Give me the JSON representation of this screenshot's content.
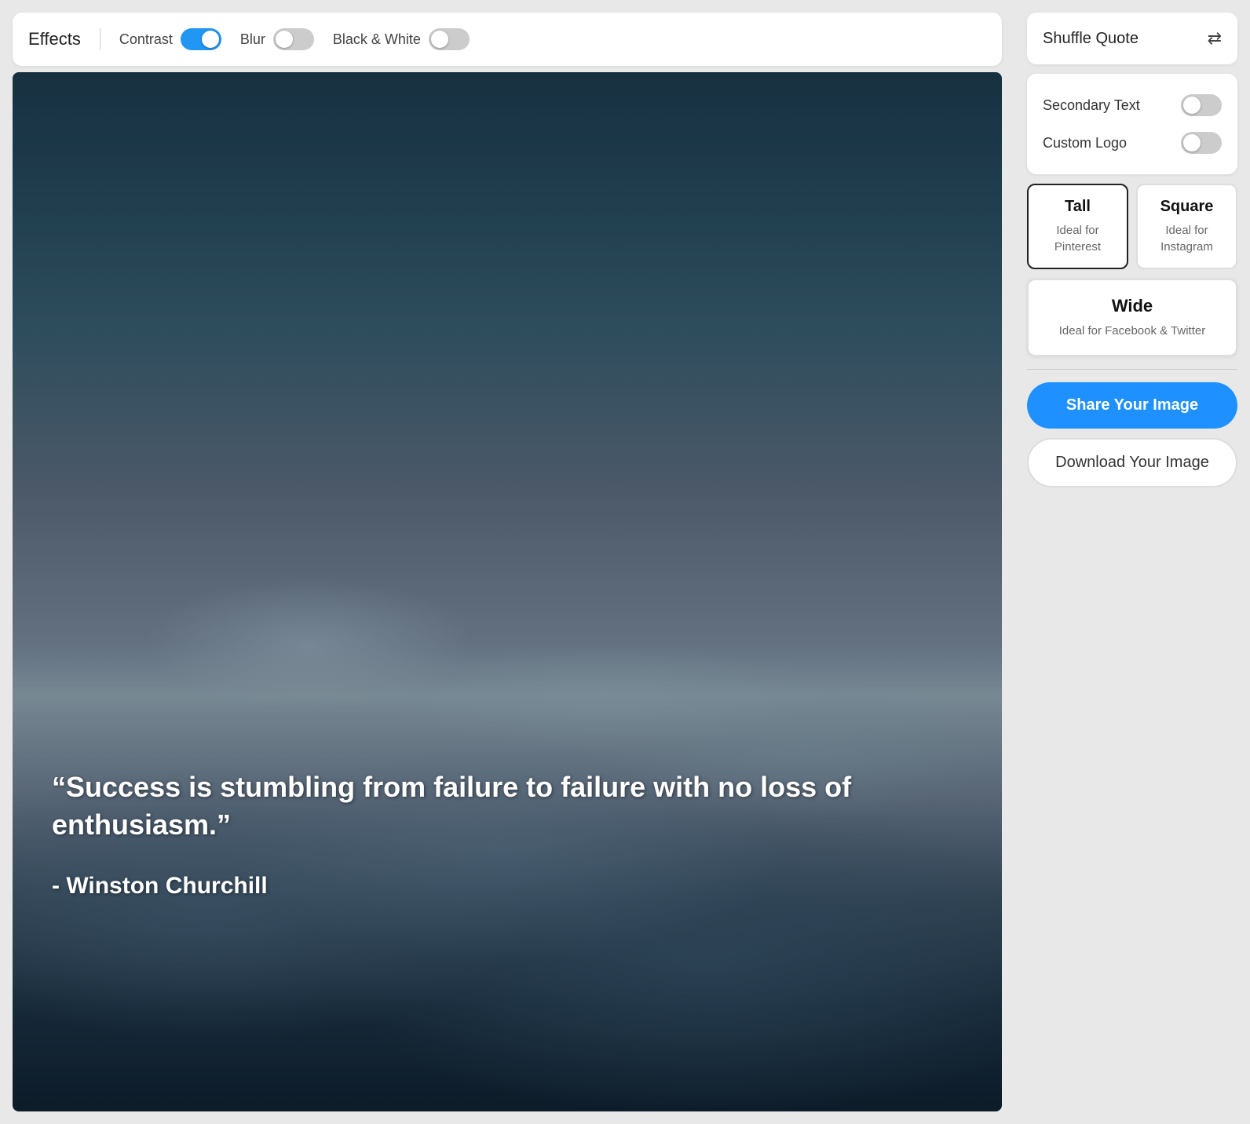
{
  "effects": {
    "label": "Effects",
    "contrast": {
      "label": "Contrast",
      "enabled": true
    },
    "blur": {
      "label": "Blur",
      "enabled": false
    },
    "blackAndWhite": {
      "label": "Black & White",
      "enabled": false
    }
  },
  "image": {
    "quote": "“Success is stumbling from failure to failure with no loss of enthusiasm.”",
    "author": "- Winston Churchill"
  },
  "sidebar": {
    "shuffleQuote": {
      "label": "Shuffle Quote"
    },
    "secondaryText": {
      "label": "Secondary Text",
      "enabled": false
    },
    "customLogo": {
      "label": "Custom Logo",
      "enabled": false
    },
    "formats": [
      {
        "id": "tall",
        "title": "Tall",
        "subtitle": "Ideal for Pinterest",
        "selected": true
      },
      {
        "id": "square",
        "title": "Square",
        "subtitle": "Ideal for Instagram",
        "selected": false
      }
    ],
    "wideFormat": {
      "title": "Wide",
      "subtitle": "Ideal for Facebook & Twitter",
      "selected": false
    },
    "shareButton": "Share Your Image",
    "downloadButton": "Download Your Image"
  }
}
